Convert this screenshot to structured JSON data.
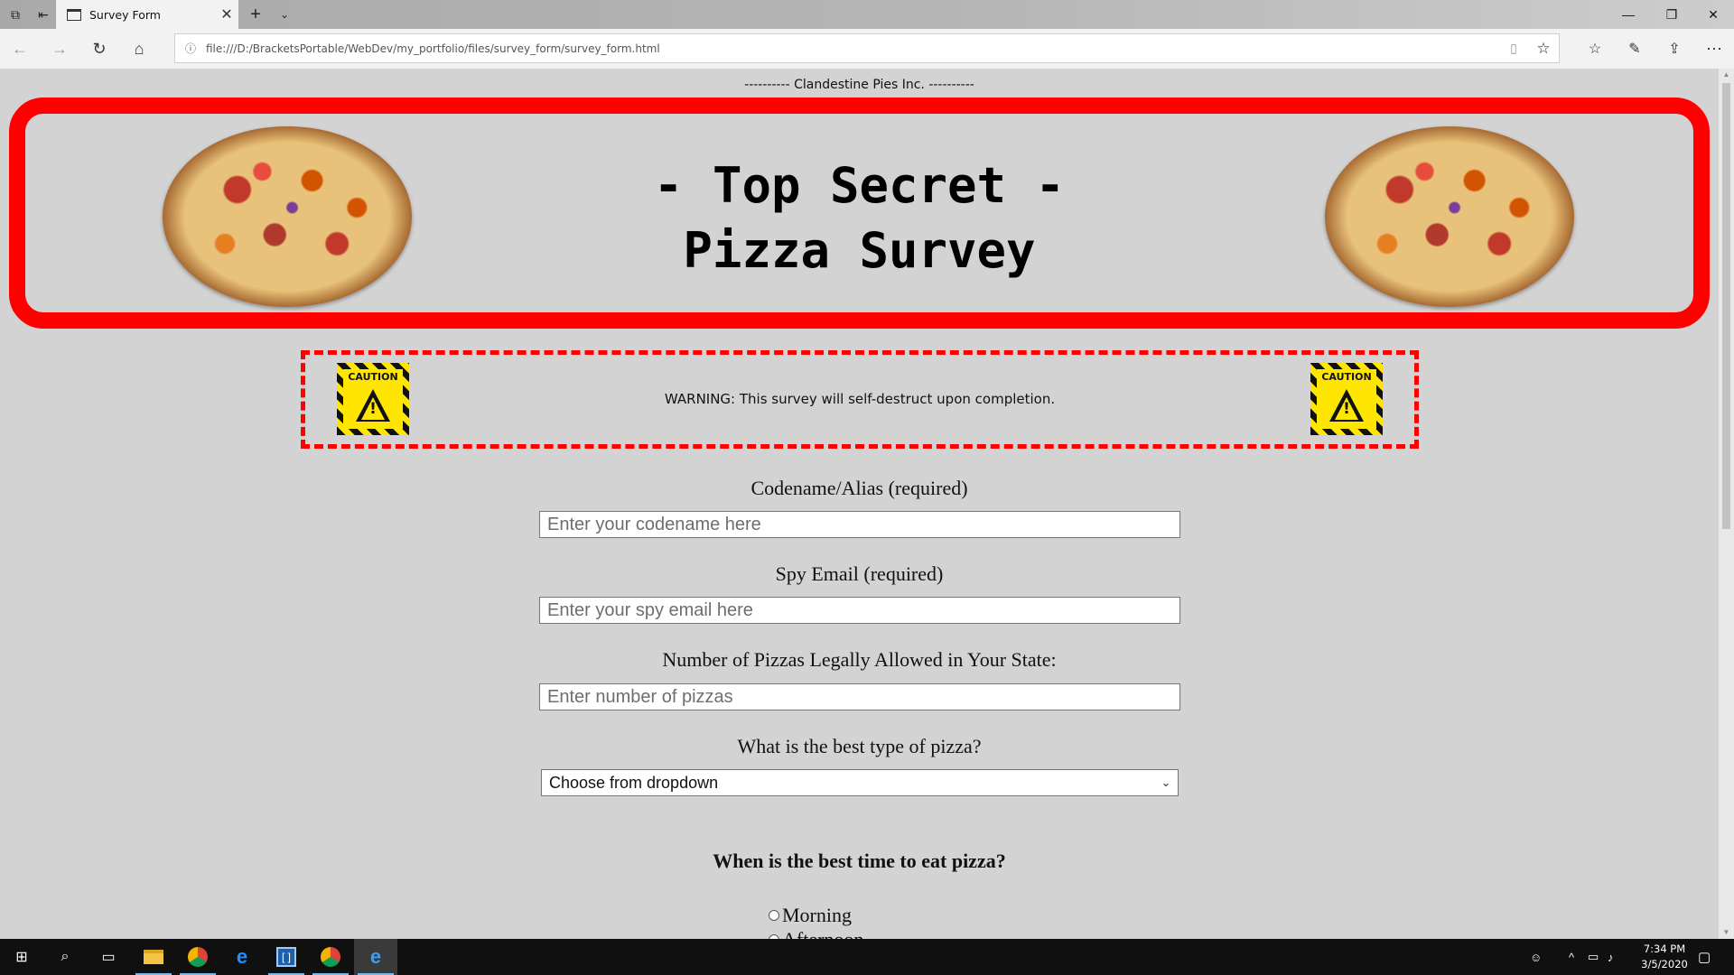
{
  "browser": {
    "tab_title": "Survey Form",
    "url": "file:///D:/BracketsPortable/WebDev/my_portfolio/files/survey_form/survey_form.html"
  },
  "page": {
    "company": "---------- Clandestine Pies Inc. ----------",
    "title_line1": "- Top Secret -",
    "title_line2": "Pizza Survey",
    "warning": "WARNING: This survey will self-destruct upon completion.",
    "caution_label": "CAUTION",
    "fields": {
      "codename": {
        "label": "Codename/Alias (required)",
        "placeholder": "Enter your codename here"
      },
      "email": {
        "label": "Spy Email (required)",
        "placeholder": "Enter your spy email here"
      },
      "pizzas": {
        "label": "Number of Pizzas Legally Allowed in Your State:",
        "placeholder": "Enter number of pizzas"
      },
      "type": {
        "label": "What is the best type of pizza?",
        "selected": "Choose from dropdown"
      }
    },
    "time_question": "When is the best time to eat pizza?",
    "time_options": [
      "Morning",
      "Afternoon"
    ]
  },
  "taskbar": {
    "time": "7:34 PM",
    "date": "3/5/2020"
  },
  "colors": {
    "page_bg": "#d3d3d3",
    "accent_red": "#ff0000",
    "caution_yellow": "#ffe600"
  }
}
